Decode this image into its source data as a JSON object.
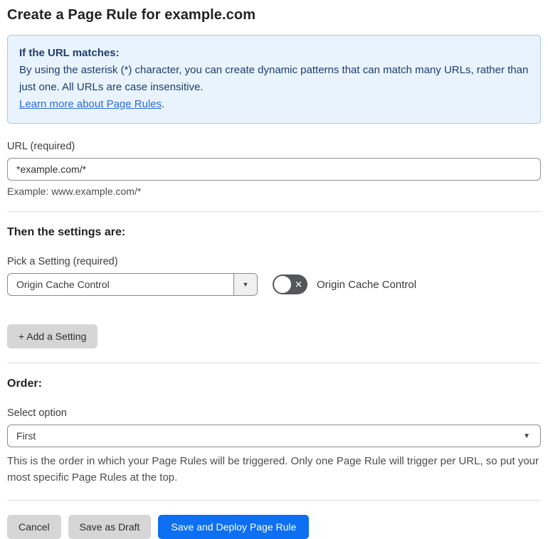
{
  "page": {
    "title": "Create a Page Rule for example.com"
  },
  "info_box": {
    "heading": "If the URL matches:",
    "body": "By using the asterisk (*) character, you can create dynamic patterns that can match many URLs, rather than just one. All URLs are case insensitive.",
    "link_label": "Learn more about Page Rules",
    "link_suffix": "."
  },
  "url_field": {
    "label": "URL (required)",
    "value": "*example.com/*",
    "helper": "Example: www.example.com/*"
  },
  "settings_section": {
    "heading": "Then the settings are:",
    "picker_label": "Pick a Setting (required)",
    "picker_value": "Origin Cache Control",
    "toggle_label": "Origin Cache Control",
    "toggle_state": "off",
    "add_setting_label": "+ Add a Setting"
  },
  "order_section": {
    "heading": "Order:",
    "select_label": "Select option",
    "select_value": "First",
    "helper": "This is the order in which your Page Rules will be triggered. Only one Page Rule will trigger per URL, so put your most specific Page Rules at the top."
  },
  "actions": {
    "cancel_label": "Cancel",
    "save_draft_label": "Save as Draft",
    "save_deploy_label": "Save and Deploy Page Rule"
  },
  "icons": {
    "dropdown_arrow": "▼",
    "toggle_x": "✕"
  },
  "colors": {
    "primary_blue": "#0d6ff2",
    "info_bg": "#e9f3fd",
    "info_border": "#a9c7ea",
    "info_text": "#1e3c6e",
    "link_blue": "#2c6cd4",
    "button_gray": "#d6d6d6",
    "toggle_gray": "#54565a"
  }
}
